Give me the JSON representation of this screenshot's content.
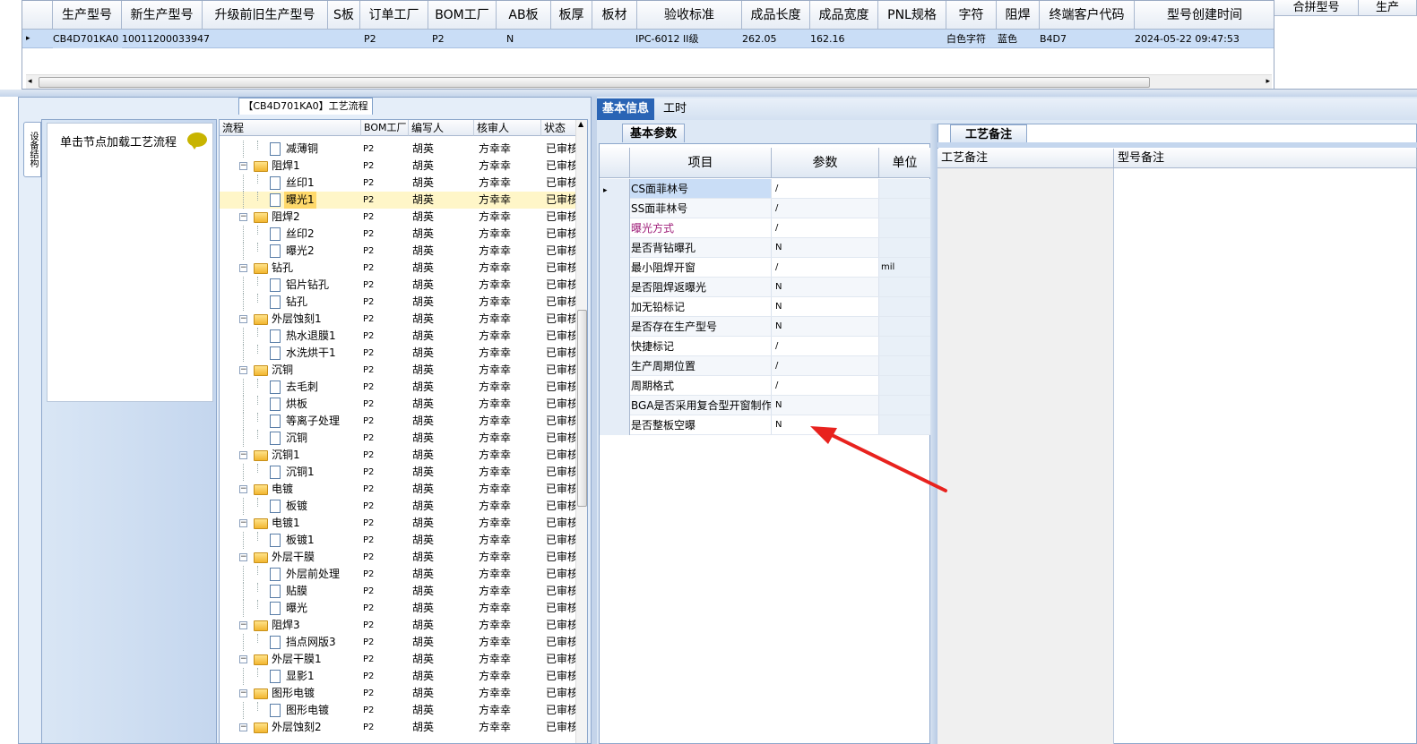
{
  "top_grid": {
    "columns": [
      "生产型号",
      "新生产型号",
      "升级前旧生产型号",
      "S板",
      "订单工厂",
      "BOM工厂",
      "AB板",
      "板厚",
      "板材",
      "验收标准",
      "成品长度",
      "成品宽度",
      "PNL规格",
      "字符",
      "阻焊",
      "终端客户代码",
      "型号创建时间"
    ],
    "row": {
      "production_model": "CB4D701KA0",
      "new_model": "10011200033947",
      "old_model": "",
      "s_board": "",
      "order_factory": "P2",
      "bom_factory": "P2",
      "ab_board": "N",
      "thickness": "",
      "material": "",
      "standard": "IPC-6012 II级",
      "length": "262.05",
      "width": "162.16",
      "pnl": "",
      "char": "白色字符",
      "mask": "蓝色",
      "customer_code": "B4D7",
      "created": "2024-05-22 09:47:53"
    },
    "right_columns": [
      "合拼型号",
      "生产"
    ]
  },
  "process_tree": {
    "title": "【CB4D701KA0】工艺流程",
    "side_tab": "设备结构",
    "hint": "单击节点加载工艺流程",
    "columns": [
      "流程",
      "BOM工厂",
      "编写人",
      "核审人",
      "状态"
    ],
    "rows": [
      {
        "name": "减薄铜",
        "level": 2,
        "bom": "P2",
        "writer": "胡英",
        "checker": "方幸幸",
        "status": "已审核"
      },
      {
        "name": "阻焊1",
        "level": 1,
        "bom": "P2",
        "writer": "胡英",
        "checker": "方幸幸",
        "status": "已审核"
      },
      {
        "name": "丝印1",
        "level": 2,
        "bom": "P2",
        "writer": "胡英",
        "checker": "方幸幸",
        "status": "已审核"
      },
      {
        "name": "曝光1",
        "level": 2,
        "bom": "P2",
        "writer": "胡英",
        "checker": "方幸幸",
        "status": "已审核",
        "selected": true
      },
      {
        "name": "阻焊2",
        "level": 1,
        "bom": "P2",
        "writer": "胡英",
        "checker": "方幸幸",
        "status": "已审核"
      },
      {
        "name": "丝印2",
        "level": 2,
        "bom": "P2",
        "writer": "胡英",
        "checker": "方幸幸",
        "status": "已审核"
      },
      {
        "name": "曝光2",
        "level": 2,
        "bom": "P2",
        "writer": "胡英",
        "checker": "方幸幸",
        "status": "已审核"
      },
      {
        "name": "钻孔",
        "level": 1,
        "bom": "P2",
        "writer": "胡英",
        "checker": "方幸幸",
        "status": "已审核"
      },
      {
        "name": "铝片钻孔",
        "level": 2,
        "bom": "P2",
        "writer": "胡英",
        "checker": "方幸幸",
        "status": "已审核"
      },
      {
        "name": "钻孔",
        "level": 2,
        "bom": "P2",
        "writer": "胡英",
        "checker": "方幸幸",
        "status": "已审核"
      },
      {
        "name": "外层蚀刻1",
        "level": 1,
        "bom": "P2",
        "writer": "胡英",
        "checker": "方幸幸",
        "status": "已审核"
      },
      {
        "name": "热水退膜1",
        "level": 2,
        "bom": "P2",
        "writer": "胡英",
        "checker": "方幸幸",
        "status": "已审核"
      },
      {
        "name": "水洗烘干1",
        "level": 2,
        "bom": "P2",
        "writer": "胡英",
        "checker": "方幸幸",
        "status": "已审核"
      },
      {
        "name": "沉铜",
        "level": 1,
        "bom": "P2",
        "writer": "胡英",
        "checker": "方幸幸",
        "status": "已审核"
      },
      {
        "name": "去毛刺",
        "level": 2,
        "bom": "P2",
        "writer": "胡英",
        "checker": "方幸幸",
        "status": "已审核"
      },
      {
        "name": "烘板",
        "level": 2,
        "bom": "P2",
        "writer": "胡英",
        "checker": "方幸幸",
        "status": "已审核"
      },
      {
        "name": "等离子处理",
        "level": 2,
        "bom": "P2",
        "writer": "胡英",
        "checker": "方幸幸",
        "status": "已审核"
      },
      {
        "name": "沉铜",
        "level": 2,
        "bom": "P2",
        "writer": "胡英",
        "checker": "方幸幸",
        "status": "已审核"
      },
      {
        "name": "沉铜1",
        "level": 1,
        "bom": "P2",
        "writer": "胡英",
        "checker": "方幸幸",
        "status": "已审核"
      },
      {
        "name": "沉铜1",
        "level": 2,
        "bom": "P2",
        "writer": "胡英",
        "checker": "方幸幸",
        "status": "已审核"
      },
      {
        "name": "电镀",
        "level": 1,
        "bom": "P2",
        "writer": "胡英",
        "checker": "方幸幸",
        "status": "已审核"
      },
      {
        "name": "板镀",
        "level": 2,
        "bom": "P2",
        "writer": "胡英",
        "checker": "方幸幸",
        "status": "已审核"
      },
      {
        "name": "电镀1",
        "level": 1,
        "bom": "P2",
        "writer": "胡英",
        "checker": "方幸幸",
        "status": "已审核"
      },
      {
        "name": "板镀1",
        "level": 2,
        "bom": "P2",
        "writer": "胡英",
        "checker": "方幸幸",
        "status": "已审核"
      },
      {
        "name": "外层干膜",
        "level": 1,
        "bom": "P2",
        "writer": "胡英",
        "checker": "方幸幸",
        "status": "已审核"
      },
      {
        "name": "外层前处理",
        "level": 2,
        "bom": "P2",
        "writer": "胡英",
        "checker": "方幸幸",
        "status": "已审核"
      },
      {
        "name": "贴膜",
        "level": 2,
        "bom": "P2",
        "writer": "胡英",
        "checker": "方幸幸",
        "status": "已审核"
      },
      {
        "name": "曝光",
        "level": 2,
        "bom": "P2",
        "writer": "胡英",
        "checker": "方幸幸",
        "status": "已审核"
      },
      {
        "name": "阻焊3",
        "level": 1,
        "bom": "P2",
        "writer": "胡英",
        "checker": "方幸幸",
        "status": "已审核"
      },
      {
        "name": "挡点网版3",
        "level": 2,
        "bom": "P2",
        "writer": "胡英",
        "checker": "方幸幸",
        "status": "已审核"
      },
      {
        "name": "外层干膜1",
        "level": 1,
        "bom": "P2",
        "writer": "胡英",
        "checker": "方幸幸",
        "status": "已审核"
      },
      {
        "name": "显影1",
        "level": 2,
        "bom": "P2",
        "writer": "胡英",
        "checker": "方幸幸",
        "status": "已审核"
      },
      {
        "name": "图形电镀",
        "level": 1,
        "bom": "P2",
        "writer": "胡英",
        "checker": "方幸幸",
        "status": "已审核"
      },
      {
        "name": "图形电镀",
        "level": 2,
        "bom": "P2",
        "writer": "胡英",
        "checker": "方幸幸",
        "status": "已审核"
      },
      {
        "name": "外层蚀刻2",
        "level": 1,
        "bom": "P2",
        "writer": "胡英",
        "checker": "方幸幸",
        "status": "已审核"
      }
    ]
  },
  "tabs": [
    "基本信息",
    "工时"
  ],
  "params": {
    "tab": "基本参数",
    "columns": [
      "项目",
      "参数",
      "单位"
    ],
    "rows": [
      {
        "item": "CS面菲林号",
        "value": "/",
        "unit": ""
      },
      {
        "item": "SS面菲林号",
        "value": "/",
        "unit": ""
      },
      {
        "item": "曝光方式",
        "value": "/",
        "unit": "",
        "color": "#a0207a"
      },
      {
        "item": "是否背钻曝孔",
        "value": "N",
        "unit": ""
      },
      {
        "item": "最小阻焊开窗",
        "value": "/",
        "unit": "mil"
      },
      {
        "item": "是否阻焊返曝光",
        "value": "N",
        "unit": ""
      },
      {
        "item": "加无铅标记",
        "value": "N",
        "unit": ""
      },
      {
        "item": "是否存在生产型号",
        "value": "N",
        "unit": ""
      },
      {
        "item": "快捷标记",
        "value": "/",
        "unit": ""
      },
      {
        "item": "生产周期位置",
        "value": "/",
        "unit": ""
      },
      {
        "item": "周期格式",
        "value": "/",
        "unit": ""
      },
      {
        "item": "BGA是否采用复合型开窗制作",
        "value": "N",
        "unit": ""
      },
      {
        "item": "是否整板空曝",
        "value": "N",
        "unit": ""
      }
    ]
  },
  "notes": {
    "tab": "工艺备注",
    "columns": [
      "工艺备注",
      "型号备注"
    ]
  },
  "colors": {
    "accent": "#2a64b5",
    "arrow": "#e8221e",
    "selected_row": "#c9ddf6",
    "tree_selected": "#ffd96b"
  }
}
